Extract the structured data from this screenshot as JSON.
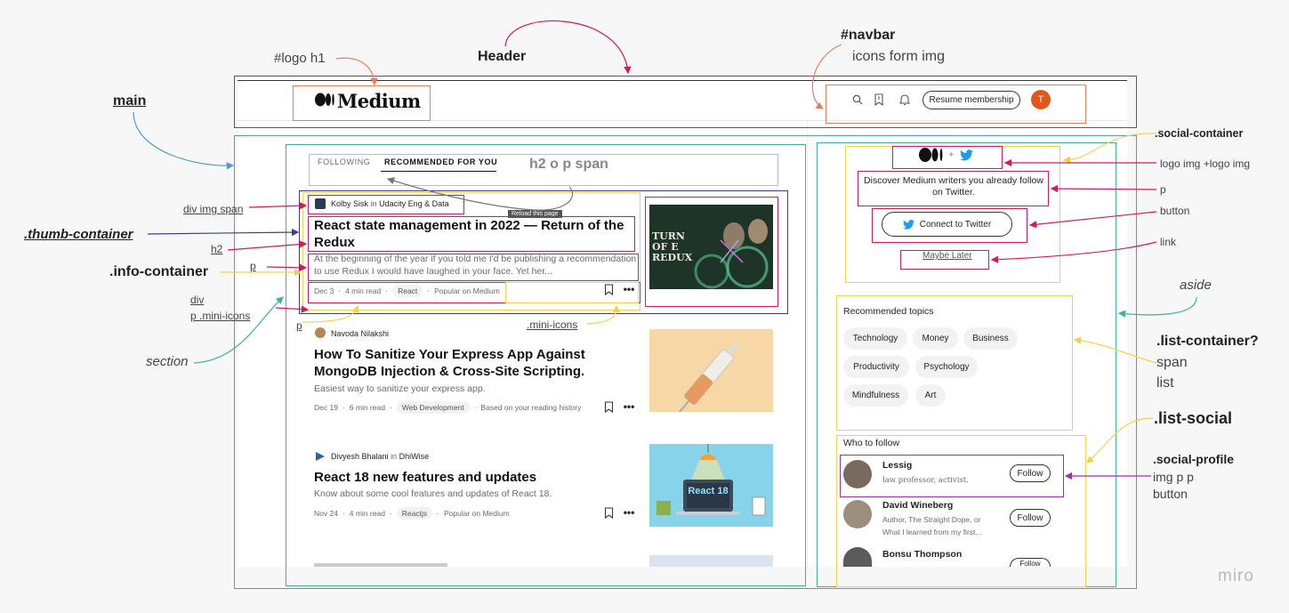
{
  "annotations": {
    "logo_h1": "#logo h1",
    "header": "Header",
    "navbar": "#navbar",
    "navbar_sub": "icons form img",
    "main": "main",
    "div_img_span": "div img span",
    "thumb_container": ".thumb-container",
    "h2": "h2",
    "p1": "p",
    "info_container": ".info-container",
    "div": "div",
    "p_mini_icons": "p .mini-icons",
    "p2": "p",
    "section": "section",
    "mini_icons": ".mini-icons",
    "h2_o_p_span": "h2 o p span",
    "social_container": ".social-container",
    "logo_img_logo_img": "logo img +logo img",
    "p3": "p",
    "button": "button",
    "link": "link",
    "aside": "aside",
    "list_container": ".list-container?",
    "span": "span",
    "list": "list",
    "list_social": ".list-social",
    "social_profile": ".social-profile",
    "img_p_p": "img p p",
    "button2": "button",
    "watermark": "miro"
  },
  "header": {
    "logo": "Medium",
    "resume_button": "Resume membership",
    "avatar_initial": "T",
    "icons": [
      "search-icon",
      "bookmark-icon",
      "bell-icon"
    ]
  },
  "tabs": {
    "following": "FOLLOWING",
    "recommended": "RECOMMENDED FOR YOU",
    "tooltip": "Reload this page"
  },
  "articles": [
    {
      "author": "Kolby Sisk",
      "in": "in",
      "publication": "Udacity Eng & Data",
      "title": "React state management in 2022 — Return of the Redux",
      "subtitle": "At the beginning of the year if you told me I'd be publishing a recommendation to use Redux I would have laughed in your face. Yet her...",
      "date": "Dec 3",
      "read": "4 min read",
      "tag": "React",
      "reason": "Popular on Medium",
      "thumb_text": "TURN OF E REDUX"
    },
    {
      "author": "Navoda Nilakshi",
      "in": "",
      "publication": "",
      "title": "How To Sanitize Your Express App Against MongoDB Injection & Cross-Site Scripting.",
      "subtitle": "Easiest way to sanitize your express app.",
      "date": "Dec 19",
      "read": "6 min read",
      "tag": "Web Development",
      "reason": "Based on your reading history"
    },
    {
      "author": "Divyesh Bhalani",
      "in": "in",
      "publication": "DhiWise",
      "title": "React 18 new features and updates",
      "subtitle": "Know about some cool features and updates of React 18.",
      "date": "Nov 24",
      "read": "4 min read",
      "tag": "Reactjs",
      "reason": "Popular on Medium",
      "thumb_text": "React 18"
    }
  ],
  "aside": {
    "social_text": "Discover Medium writers you already follow on Twitter.",
    "connect_button": "Connect to Twitter",
    "maybe_later": "Maybe Later",
    "topics_heading": "Recommended topics",
    "topics": [
      "Technology",
      "Money",
      "Business",
      "Productivity",
      "Psychology",
      "Mindfulness",
      "Art"
    ],
    "follow_heading": "Who to follow",
    "profiles": [
      {
        "name": "Lessig",
        "bio": "law professor, activist.",
        "button": "Follow"
      },
      {
        "name": "David Wineberg",
        "bio": "Author, The Straight Dope, or What I learned from my first...",
        "button": "Follow"
      },
      {
        "name": "Bonsu Thompson",
        "bio": "",
        "button": "Follow"
      }
    ]
  },
  "colors": {
    "header_box": "#d6195d",
    "logo_box": "#f07b5a",
    "main_box": "#4f9ad6",
    "section_box": "#3db39e",
    "aside_box": "#f0d34d",
    "profile_box": "#9b2fae",
    "avatar": "#e2561c",
    "twitter": "#1d9bf0"
  }
}
